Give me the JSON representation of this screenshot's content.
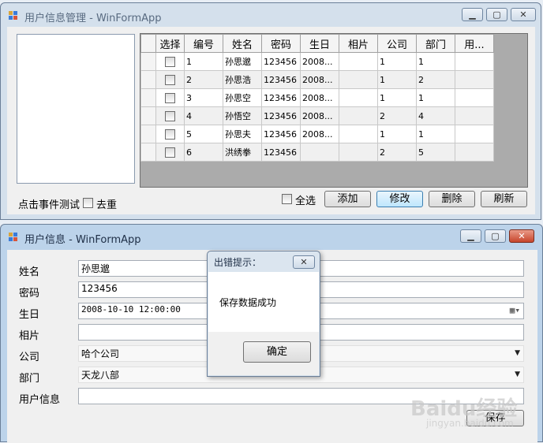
{
  "top_window": {
    "title": "用户信息管理 - WinFormApp",
    "controls": {
      "minimize": "▁",
      "maximize": "▢",
      "close": "✕"
    },
    "grid": {
      "columns": [
        "选择",
        "编号",
        "姓名",
        "密码",
        "生日",
        "相片",
        "公司",
        "部门",
        "用..."
      ],
      "rows": [
        [
          "",
          "1",
          "孙思邈",
          "123456",
          "2008...",
          "",
          "1",
          "1",
          ""
        ],
        [
          "",
          "2",
          "孙思浩",
          "123456",
          "2008...",
          "",
          "1",
          "2",
          ""
        ],
        [
          "",
          "3",
          "孙思空",
          "123456",
          "2008...",
          "",
          "1",
          "1",
          ""
        ],
        [
          "",
          "4",
          "孙悟空",
          "123456",
          "2008...",
          "",
          "2",
          "4",
          ""
        ],
        [
          "",
          "5",
          "孙思夫",
          "123456",
          "2008...",
          "",
          "1",
          "1",
          ""
        ],
        [
          "",
          "6",
          "洪绣拳",
          "123456",
          "",
          "",
          "2",
          "5",
          ""
        ]
      ]
    },
    "click_event_label": "点击事件测试",
    "dedup_label": "去重",
    "select_all_label": "全选",
    "buttons": {
      "add": "添加",
      "edit": "修改",
      "delete": "删除",
      "refresh": "刷新"
    }
  },
  "bottom_window": {
    "title": "用户信息 - WinFormApp",
    "controls": {
      "minimize": "▁",
      "maximize": "▢",
      "close": "✕"
    },
    "labels": {
      "name": "姓名",
      "password": "密码",
      "birthday": "生日",
      "photo": "相片",
      "company": "公司",
      "department": "部门",
      "user_info": "用户信息"
    },
    "values": {
      "name": "孙思邈",
      "password": "123456",
      "birthday": "2008-10-10 12:00:00",
      "photo": "",
      "company": "哈个公司",
      "department": "天龙八部",
      "user_info": ""
    },
    "save_label": "保存"
  },
  "dialog": {
    "title": "出错提示：",
    "close": "✕",
    "message": "保存数据成功",
    "ok_label": "确定"
  },
  "watermark": {
    "logo": "Baidu经验",
    "url": "jingyan.baidu.com"
  }
}
